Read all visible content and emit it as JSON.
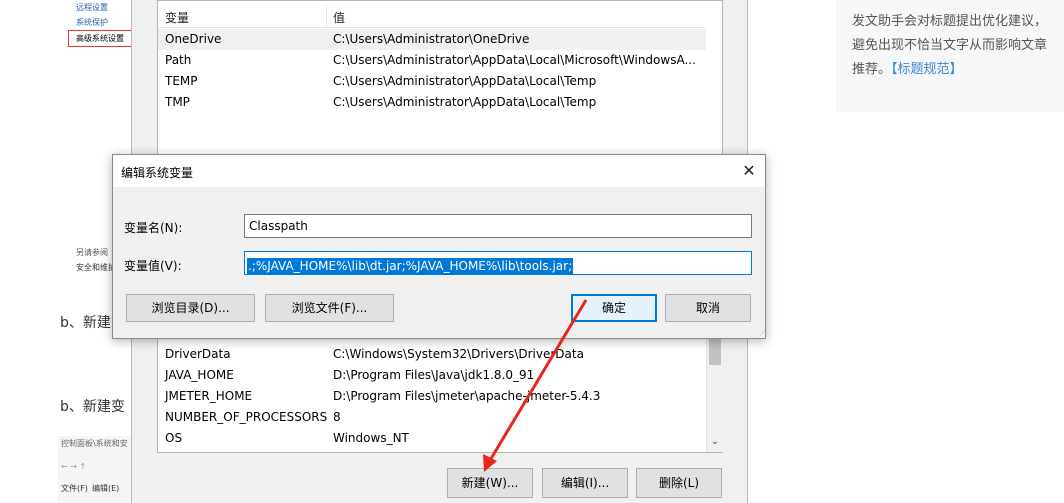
{
  "left_strip": {
    "sidebar_links": [
      "远程设置",
      "系统保护",
      "高级系统设置"
    ],
    "see_also_title": "另请参阅",
    "see_also_item": "安全和维护",
    "paragraph_b1": "b、新建",
    "paragraph_b2": "b、新建变",
    "mini_breadcrumb": "控制面板\\系统和安",
    "mini_nav": "← → ↑",
    "mini_menu": [
      "文件(F)",
      "编辑(E)"
    ]
  },
  "ad_panel": {
    "line1": "发文助手会对标题提出优化建议，",
    "line2": "避免出现不恰当文字从而影响文章",
    "line3": "推荐。",
    "link": "【标题规范】"
  },
  "env_window": {
    "user_vars": {
      "header_name": "变量",
      "header_value": "值",
      "rows": [
        {
          "name": "OneDrive",
          "value": "C:\\Users\\Administrator\\OneDrive"
        },
        {
          "name": "Path",
          "value": "C:\\Users\\Administrator\\AppData\\Local\\Microsoft\\WindowsA..."
        },
        {
          "name": "TEMP",
          "value": "C:\\Users\\Administrator\\AppData\\Local\\Temp"
        },
        {
          "name": "TMP",
          "value": "C:\\Users\\Administrator\\AppData\\Local\\Temp"
        }
      ]
    },
    "system_vars": {
      "rows": [
        {
          "name": "DriverData",
          "value": "C:\\Windows\\System32\\Drivers\\DriverData"
        },
        {
          "name": "JAVA_HOME",
          "value": "D:\\Program Files\\Java\\jdk1.8.0_91"
        },
        {
          "name": "JMETER_HOME",
          "value": "D:\\Program Files\\jmeter\\apache-jmeter-5.4.3"
        },
        {
          "name": "NUMBER_OF_PROCESSORS",
          "value": "8"
        },
        {
          "name": "OS",
          "value": "Windows_NT"
        }
      ]
    },
    "buttons": {
      "new": "新建(W)...",
      "edit": "编辑(I)...",
      "delete": "删除(L)"
    }
  },
  "dialog": {
    "title": "编辑系统变量",
    "name_label": "变量名(N):",
    "name_value": "Classpath",
    "value_label": "变量值(V):",
    "value_value": ".;%JAVA_HOME%\\lib\\dt.jar;%JAVA_HOME%\\lib\\tools.jar;",
    "browse_dir": "浏览目录(D)...",
    "browse_file": "浏览文件(F)...",
    "ok": "确定",
    "cancel": "取消",
    "close_glyph": "✕"
  },
  "annotation": {
    "arrow_color": "#e8261c",
    "highlight_color": "#e43b2f"
  }
}
